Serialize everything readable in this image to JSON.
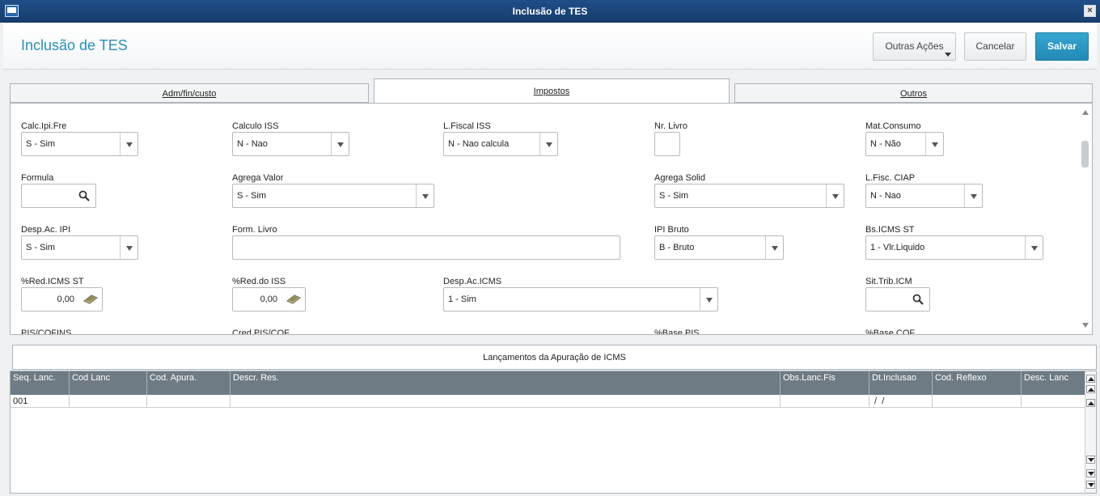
{
  "window": {
    "title": "Inclusão de TES"
  },
  "header": {
    "page_title": "Inclusão de TES",
    "more_actions": "Outras Ações",
    "cancel": "Cancelar",
    "save": "Salvar"
  },
  "tabs": [
    {
      "label": "Adm/fin/custo",
      "active": false
    },
    {
      "label": "Impostos",
      "active": true
    },
    {
      "label": "Outros",
      "active": false
    }
  ],
  "form": {
    "calc_ipi_fre": {
      "label": "Calc.Ipi.Fre",
      "value": "S - Sim"
    },
    "calculo_iss": {
      "label": "Calculo ISS",
      "value": "N - Nao"
    },
    "l_fiscal_iss": {
      "label": "L.Fiscal ISS",
      "value": "N - Nao calcula"
    },
    "nr_livro": {
      "label": "Nr. Livro",
      "value": ""
    },
    "mat_consumo": {
      "label": "Mat.Consumo",
      "value": "N - Não"
    },
    "formula": {
      "label": "Formula",
      "value": ""
    },
    "agrega_valor": {
      "label": "Agrega Valor",
      "value": "S - Sim"
    },
    "agrega_solid": {
      "label": "Agrega Solid",
      "value": "S - Sim"
    },
    "l_fisc_ciap": {
      "label": "L.Fisc. CIAP",
      "value": "N - Nao"
    },
    "desp_ac_ipi": {
      "label": "Desp.Ac. IPI",
      "value": "S - Sim"
    },
    "form_livro": {
      "label": "Form. Livro",
      "value": ""
    },
    "ipi_bruto": {
      "label": "IPI Bruto",
      "value": "B - Bruto"
    },
    "bs_icms_st": {
      "label": "Bs.ICMS ST",
      "value": "1 - Vlr.Liquido"
    },
    "red_icms_st": {
      "label": "%Red.ICMS ST",
      "value": "0,00"
    },
    "red_do_iss": {
      "label": "%Red.do ISS",
      "value": "0,00"
    },
    "desp_ac_icms": {
      "label": "Desp.Ac.ICMS",
      "value": "1 - Sim"
    },
    "sit_trib_icm": {
      "label": "Sit.Trib.ICM",
      "value": ""
    },
    "pis_cofins": {
      "label": "PIS/COFINS"
    },
    "cred_pis_cof": {
      "label": "Cred.PIS/COF"
    },
    "base_pis": {
      "label": "%Base PIS"
    },
    "base_cof": {
      "label": "%Base COF"
    }
  },
  "grid": {
    "title": "Lançamentos da Apuração de ICMS",
    "columns": [
      "Seq. Lanc.",
      "Cod Lanc",
      "Cod. Apura.",
      "Descr. Res.",
      "Obs.Lanc.Fis",
      "Dt.Inclusao",
      "Cod. Reflexo",
      "Desc. Lanc"
    ],
    "rows": [
      [
        "001",
        "",
        "",
        "",
        "",
        " /  /",
        "",
        ""
      ]
    ]
  },
  "colors": {
    "title_bar": "#1f4e88",
    "accent": "#2c8fb8",
    "save_button": "#2389b5",
    "grid_header": "#6e7b85"
  },
  "icons": [
    "app-icon",
    "close-icon",
    "search-icon",
    "calculator-icon",
    "chevron-down-icon",
    "scroll-up-icon",
    "scroll-down-icon"
  ]
}
